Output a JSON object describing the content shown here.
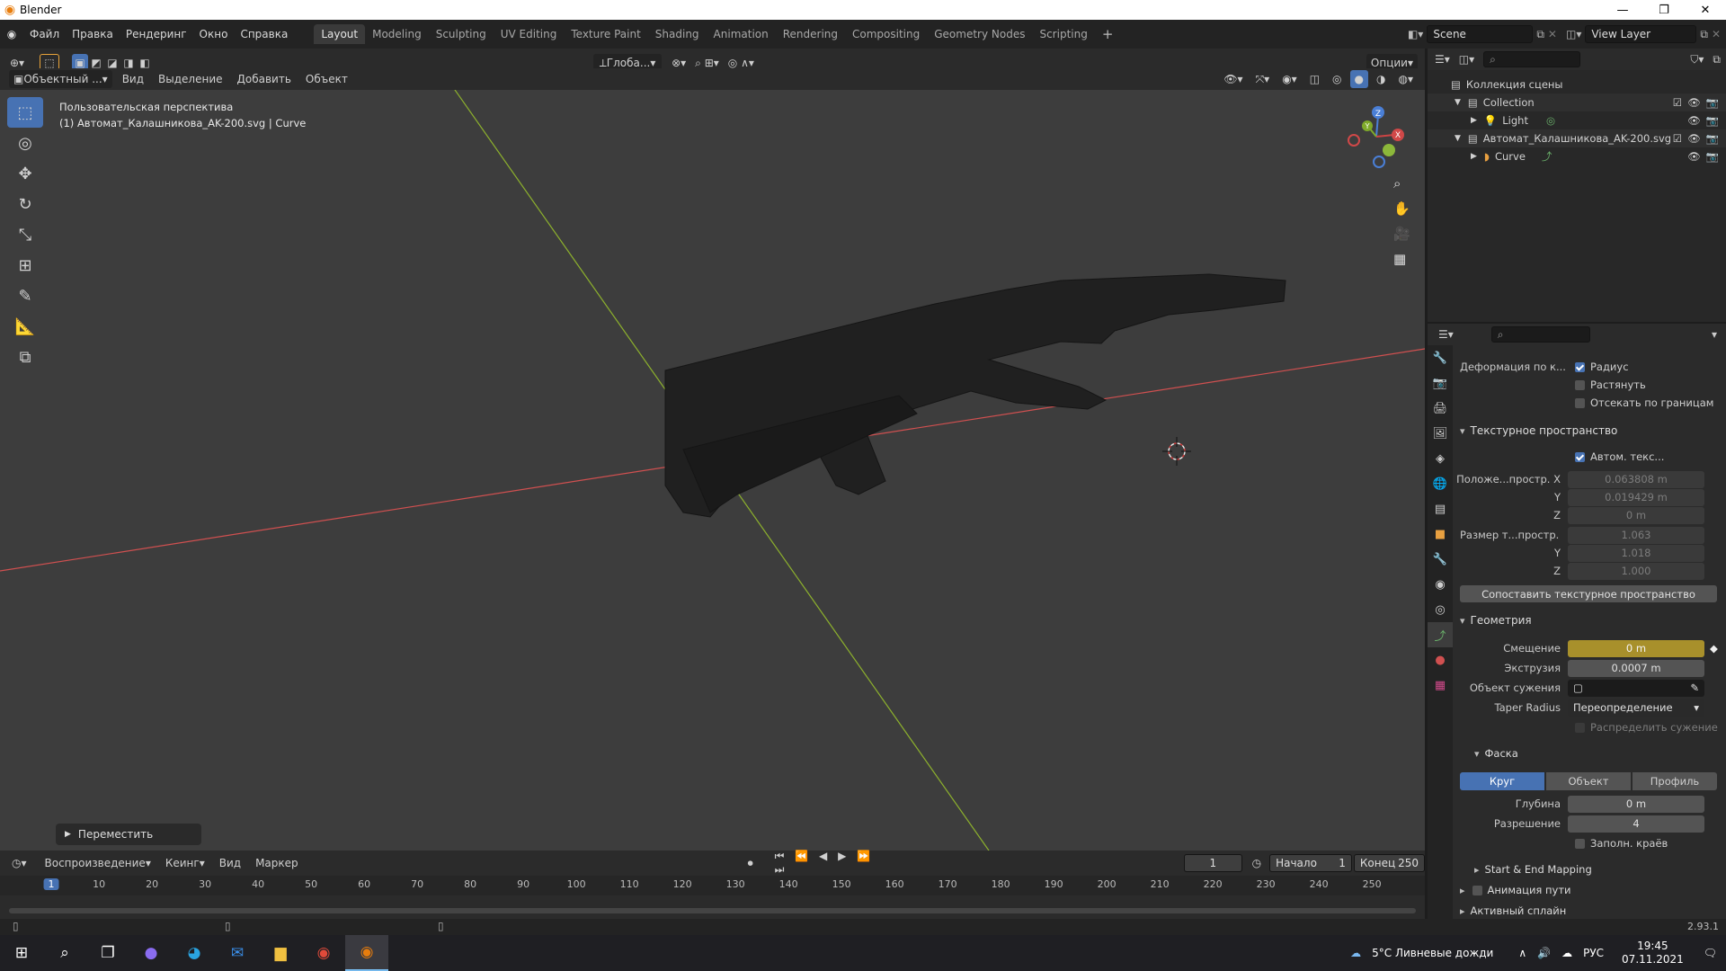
{
  "window": {
    "title": "Blender"
  },
  "menu": [
    "Файл",
    "Правка",
    "Рендеринг",
    "Окно",
    "Справка"
  ],
  "workspaces": [
    "Layout",
    "Modeling",
    "Sculpting",
    "UV Editing",
    "Texture Paint",
    "Shading",
    "Animation",
    "Rendering",
    "Compositing",
    "Geometry Nodes",
    "Scripting"
  ],
  "active_workspace": "Layout",
  "scene": {
    "name": "Scene",
    "view_layer": "View Layer"
  },
  "viewport_header": {
    "mode": "Объектный ...",
    "menus": [
      "Вид",
      "Выделение",
      "Добавить",
      "Объект"
    ],
    "transform_orientation": "Глоба...",
    "options": "Опции"
  },
  "viewport": {
    "perspective_label": "Пользовательская перспектива",
    "object_label": "(1) Автомат_Калашникова_AK-200.svg | Curve",
    "last_operator": "Переместить",
    "axis_x_color": "#d05050",
    "axis_y_color": "#8db12d"
  },
  "outliner": {
    "title": "Коллекция сцены",
    "items": [
      {
        "label": "Collection",
        "icon": "collection-icon",
        "indent": 1
      },
      {
        "label": "Light",
        "icon": "light-icon",
        "indent": 2
      },
      {
        "label": "Автомат_Калашникова_AK-200.svg",
        "icon": "collection-icon",
        "indent": 1
      },
      {
        "label": "Curve",
        "icon": "curve-icon",
        "indent": 2
      }
    ]
  },
  "properties": {
    "deform_label": "Деформация по к...",
    "radius": "Радиус",
    "stretch": "Растянуть",
    "clip_bounds": "Отсекать по границам",
    "texspace_section": "Текстурное пространство",
    "auto_texspace": "Автом. текс...",
    "loc_label": "Положе...простр. X",
    "loc_x": "0.063808 m",
    "loc_y": "0.019429 m",
    "loc_z": "0 m",
    "size_label": "Размер т...простр.",
    "size_x": "1.063",
    "size_y": "1.018",
    "size_z": "1.000",
    "axis_y": "Y",
    "axis_z": "Z",
    "match_texspace": "Сопоставить текстурное пространство",
    "geometry_section": "Геометрия",
    "offset_label": "Смещение",
    "offset": "0 m",
    "extrude_label": "Экструзия",
    "extrude": "0.0007 m",
    "taper_label": "Объект сужения",
    "taper_radius_label": "Taper Radius",
    "taper_radius": "Переопределение",
    "taper_distribute": "Распределить сужение",
    "bevel_section": "Фаска",
    "bevel_modes": [
      "Круг",
      "Объект",
      "Профиль"
    ],
    "depth_label": "Глубина",
    "depth": "0 m",
    "resolution_label": "Разрешение",
    "resolution": "4",
    "fill_caps": "Заполн. краёв",
    "start_end": "Start & End Mapping",
    "path_anim": "Анимация пути",
    "active_spline": "Активный сплайн"
  },
  "timeline": {
    "menus": [
      "Воспроизведение",
      "Кеинг",
      "Вид",
      "Маркер"
    ],
    "current_frame": "1",
    "start_label": "Начало",
    "start": "1",
    "end_label": "Конец",
    "end": "250",
    "ticks": [
      "1",
      "10",
      "20",
      "30",
      "40",
      "50",
      "60",
      "70",
      "80",
      "90",
      "100",
      "110",
      "120",
      "130",
      "140",
      "150",
      "160",
      "170",
      "180",
      "190",
      "200",
      "210",
      "220",
      "230",
      "240",
      "250"
    ]
  },
  "status": {
    "version": "2.93.1"
  },
  "taskbar": {
    "weather": "5°C  Ливневые дожди",
    "lang": "РУС",
    "time": "19:45",
    "date": "07.11.2021"
  }
}
